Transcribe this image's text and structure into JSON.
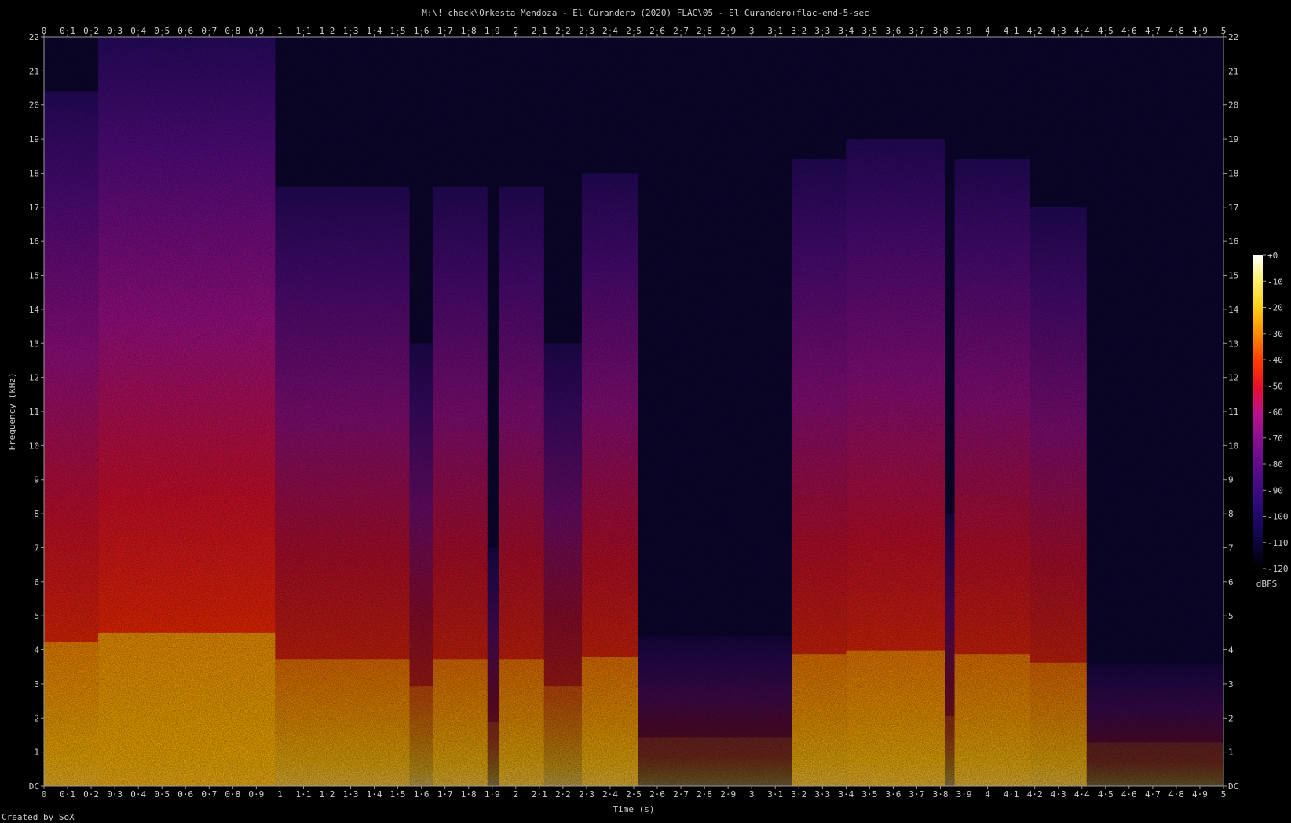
{
  "window": {
    "title": "M:\\! check\\Orkesta Mendoza - El Curandero (2020) FLAC\\05 - El Curandero+flac-end-5-sec",
    "footer": "Created by SoX"
  },
  "chart_data": {
    "type": "heatmap",
    "title": "M:\\! check\\Orkesta Mendoza - El Curandero (2020) FLAC\\05 - El Curandero+flac-end-5-sec",
    "xlabel": "Time (s)",
    "ylabel": "Frequency (kHz)",
    "xlim": [
      0,
      5
    ],
    "ylim": [
      0,
      22
    ],
    "x_ticks": [
      "0",
      "0·1",
      "0·2",
      "0·3",
      "0·4",
      "0·5",
      "0·6",
      "0·7",
      "0·8",
      "0·9",
      "1",
      "1·1",
      "1·2",
      "1·3",
      "1·4",
      "1·5",
      "1·6",
      "1·7",
      "1·8",
      "1·9",
      "2",
      "2·1",
      "2·2",
      "2·3",
      "2·4",
      "2·5",
      "2·6",
      "2·7",
      "2·8",
      "2·9",
      "3",
      "3·1",
      "3·2",
      "3·3",
      "3·4",
      "3·5",
      "3·6",
      "3·7",
      "3·8",
      "3·9",
      "4",
      "4·1",
      "4·2",
      "4·3",
      "4·4",
      "4·5",
      "4·6",
      "4·7",
      "4·8",
      "4·9",
      "5"
    ],
    "y_ticks": [
      "DC",
      "1",
      "2",
      "3",
      "4",
      "5",
      "6",
      "7",
      "8",
      "9",
      "10",
      "11",
      "12",
      "13",
      "14",
      "15",
      "16",
      "17",
      "18",
      "19",
      "20",
      "21",
      "22"
    ],
    "colorbar": {
      "label": "dBFS",
      "ticks": [
        "+0",
        "-10",
        "-20",
        "-30",
        "-40",
        "-50",
        "-60",
        "-70",
        "-80",
        "-90",
        "-100",
        "-110",
        "-120"
      ],
      "range": [
        -120,
        0
      ],
      "colors": [
        "#000000",
        "#0e0640",
        "#2a0a78",
        "#5a0c8c",
        "#8c1090",
        "#c0108a",
        "#e8102a",
        "#ff3a00",
        "#ff8c00",
        "#ffd21a",
        "#fff27a",
        "#ffffff"
      ]
    },
    "segments": [
      {
        "t0": 0.0,
        "t1": 0.23,
        "level": 0.92
      },
      {
        "t0": 0.23,
        "t1": 0.98,
        "level": 1.0
      },
      {
        "t0": 0.98,
        "t1": 1.55,
        "level": 0.78
      },
      {
        "t0": 1.55,
        "t1": 1.65,
        "level": 0.55
      },
      {
        "t0": 1.65,
        "t1": 1.88,
        "level": 0.78
      },
      {
        "t0": 1.88,
        "t1": 1.93,
        "level": 0.25
      },
      {
        "t0": 1.93,
        "t1": 2.12,
        "level": 0.78
      },
      {
        "t0": 2.12,
        "t1": 2.28,
        "level": 0.55
      },
      {
        "t0": 2.28,
        "t1": 2.52,
        "level": 0.8
      },
      {
        "t0": 2.52,
        "t1": 3.17,
        "level": 0.12
      },
      {
        "t0": 3.17,
        "t1": 3.4,
        "level": 0.82
      },
      {
        "t0": 3.4,
        "t1": 3.82,
        "level": 0.85
      },
      {
        "t0": 3.82,
        "t1": 3.86,
        "level": 0.3
      },
      {
        "t0": 3.86,
        "t1": 4.18,
        "level": 0.82
      },
      {
        "t0": 4.18,
        "t1": 4.42,
        "level": 0.75
      },
      {
        "t0": 4.42,
        "t1": 5.0,
        "level": 0.08
      }
    ]
  }
}
